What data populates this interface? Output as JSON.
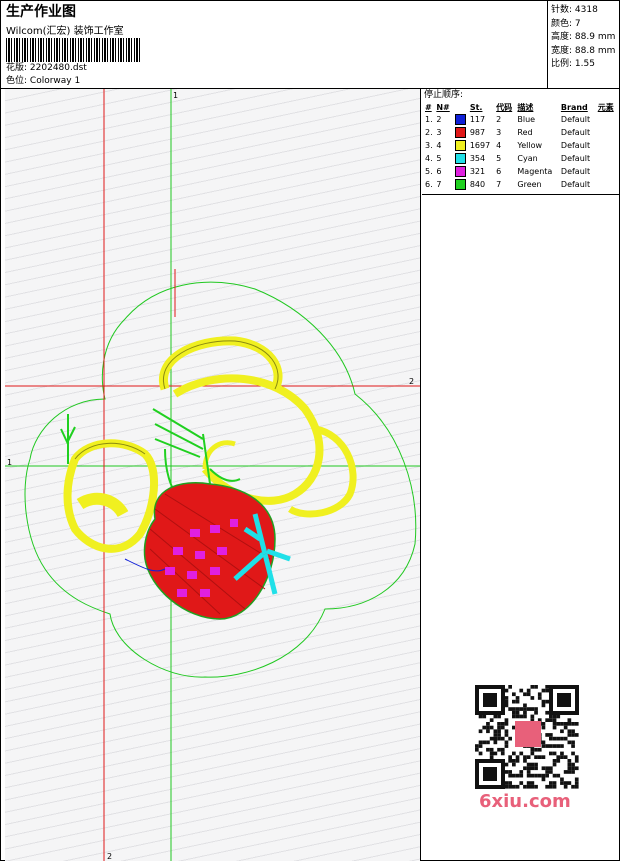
{
  "header": {
    "title": "生产作业图",
    "company": "Wilcom(汇宏) 装饰工作室",
    "design_label": "花版:",
    "design_value": "2202480.dst",
    "colorway_label": "色位:",
    "colorway_value": "Colorway 1"
  },
  "stats": {
    "stitches_label": "针数:",
    "stitches_value": "4318",
    "colors_label": "颜色:",
    "colors_value": "7",
    "height_label": "高度:",
    "height_value": "88.9 mm",
    "width_label": "宽度:",
    "width_value": "88.8 mm",
    "scale_label": "比例:",
    "scale_value": "1.55"
  },
  "stop_sequence": {
    "title": "停止顺序:",
    "headers": [
      "#",
      "N#",
      "",
      "St.",
      "代码",
      "描述",
      "Brand",
      "元素"
    ],
    "rows": [
      {
        "idx": "1.",
        "n": "2",
        "color": "#1020d8",
        "st": "117",
        "code": "2",
        "desc": "Blue",
        "brand": "Default"
      },
      {
        "idx": "2.",
        "n": "3",
        "color": "#e01818",
        "st": "987",
        "code": "3",
        "desc": "Red",
        "brand": "Default"
      },
      {
        "idx": "3.",
        "n": "4",
        "color": "#f0f020",
        "st": "1697",
        "code": "4",
        "desc": "Yellow",
        "brand": "Default"
      },
      {
        "idx": "4.",
        "n": "5",
        "color": "#20e0e8",
        "st": "354",
        "code": "5",
        "desc": "Cyan",
        "brand": "Default"
      },
      {
        "idx": "5.",
        "n": "6",
        "color": "#e020e0",
        "st": "321",
        "code": "6",
        "desc": "Magenta",
        "brand": "Default"
      },
      {
        "idx": "6.",
        "n": "7",
        "color": "#20d020",
        "st": "840",
        "code": "7",
        "desc": "Green",
        "brand": "Default"
      }
    ]
  },
  "guides": {
    "vertical_green_label": "1",
    "horizontal_green_label": "1",
    "horizontal_red_label": "2",
    "vertical_red_label": "2"
  },
  "watermark": "6xiu.com",
  "colors": {
    "green_guide": "#20c820",
    "red_guide": "#e01818",
    "yellow": "#f0f020",
    "red": "#e01818",
    "cyan": "#20e0e8",
    "magenta": "#e020e0",
    "green": "#20d020",
    "blue": "#1020d8"
  }
}
